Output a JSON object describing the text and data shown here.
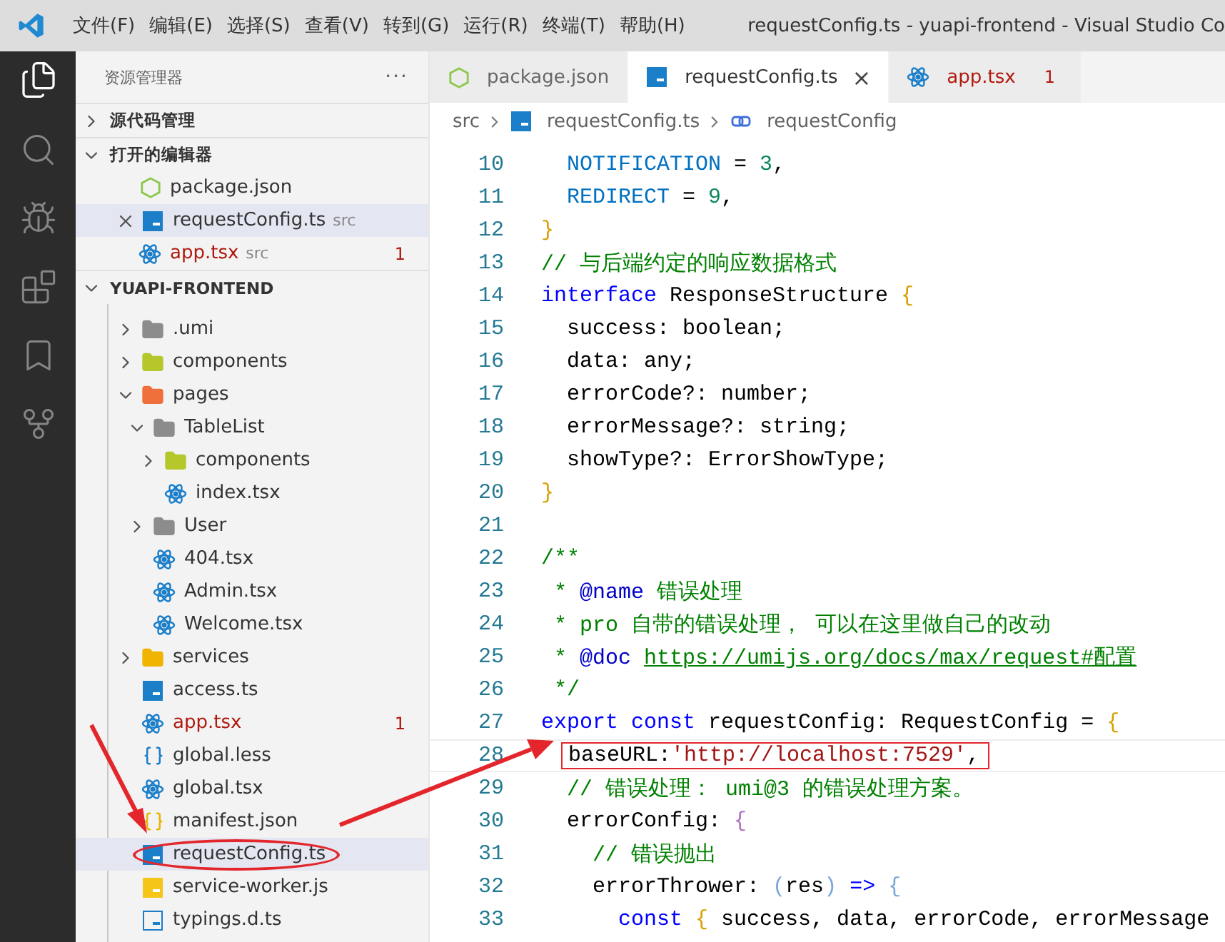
{
  "window": {
    "title": "requestConfig.ts - yuapi-frontend - Visual Studio Co"
  },
  "menu": [
    "文件(F)",
    "编辑(E)",
    "选择(S)",
    "查看(V)",
    "转到(G)",
    "运行(R)",
    "终端(T)",
    "帮助(H)"
  ],
  "activity_bar": [
    {
      "kind": "files",
      "selected": true
    },
    {
      "kind": "search",
      "selected": false
    },
    {
      "kind": "debug",
      "selected": false
    },
    {
      "kind": "extensions",
      "selected": false
    },
    {
      "kind": "bookmark",
      "selected": false
    },
    {
      "kind": "source",
      "selected": false
    }
  ],
  "sidebar": {
    "title": "资源管理器",
    "more": "···",
    "sections": [
      {
        "title": "源代码管理",
        "expanded": false
      },
      {
        "title": "打开的编辑器",
        "expanded": true
      },
      {
        "title": "YUAPI-FRONTEND",
        "expanded": true
      }
    ],
    "open_editors": [
      {
        "name": "package.json",
        "kind": "json",
        "selected": false,
        "error": false
      },
      {
        "name": "requestConfig.ts",
        "folder": "src",
        "kind": "ts",
        "selected": true,
        "error": false
      },
      {
        "name": "app.tsx",
        "folder": "src",
        "kind": "react",
        "selected": false,
        "error": true,
        "badge": "1"
      }
    ],
    "tree": [
      {
        "name": ".umi",
        "kind": "folder",
        "expanded": false
      },
      {
        "name": "components",
        "kind": "folder-components",
        "expanded": false
      },
      {
        "name": "pages",
        "kind": "folder-pages",
        "expanded": true,
        "children": [
          {
            "name": "TableList",
            "kind": "folder",
            "expanded": true,
            "children": [
              {
                "name": "components",
                "kind": "folder-components",
                "expanded": false
              },
              {
                "name": "index.tsx",
                "kind": "react"
              }
            ]
          },
          {
            "name": "User",
            "kind": "folder",
            "expanded": false
          },
          {
            "name": "404.tsx",
            "kind": "react"
          },
          {
            "name": "Admin.tsx",
            "kind": "react"
          },
          {
            "name": "Welcome.tsx",
            "kind": "react"
          }
        ]
      },
      {
        "name": "services",
        "kind": "folder-services",
        "expanded": false
      },
      {
        "name": "access.ts",
        "kind": "ts"
      },
      {
        "name": "app.tsx",
        "kind": "react",
        "error": true,
        "badge": "1"
      },
      {
        "name": "global.less",
        "kind": "less"
      },
      {
        "name": "global.tsx",
        "kind": "react"
      },
      {
        "name": "manifest.json",
        "kind": "manifest"
      },
      {
        "name": "requestConfig.ts",
        "kind": "ts",
        "selected": true,
        "circled": true
      },
      {
        "name": "service-worker.js",
        "kind": "js"
      },
      {
        "name": "typings.d.ts",
        "kind": "ts-outline"
      }
    ]
  },
  "tabs": [
    {
      "label": "package.json",
      "kind": "json",
      "selected": false,
      "error": false
    },
    {
      "label": "requestConfig.ts",
      "kind": "ts",
      "selected": true,
      "error": false,
      "close": "×"
    },
    {
      "label": "app.tsx",
      "kind": "react",
      "selected": false,
      "error": true,
      "badge": "1"
    }
  ],
  "breadcrumb": [
    {
      "label": "src",
      "kind": "folder"
    },
    {
      "label": "requestConfig.ts",
      "kind": "ts"
    },
    {
      "label": "requestConfig",
      "kind": "symbol"
    }
  ],
  "editor": {
    "lines": [
      {
        "number": "10",
        "tokens": [
          {
            "kind": "enum",
            "text": "  NOTIFICATION"
          },
          {
            "kind": "plain",
            "text": " = "
          },
          {
            "kind": "number",
            "text": "3"
          },
          {
            "kind": "plain",
            "text": ","
          }
        ]
      },
      {
        "number": "11",
        "tokens": [
          {
            "kind": "enum",
            "text": "  REDIRECT"
          },
          {
            "kind": "plain",
            "text": " = "
          },
          {
            "kind": "number",
            "text": "9"
          },
          {
            "kind": "plain",
            "text": ","
          }
        ]
      },
      {
        "number": "12",
        "tokens": [
          {
            "kind": "brace",
            "text": "}"
          }
        ]
      },
      {
        "number": "13",
        "tokens": [
          {
            "kind": "comment",
            "text": "// 与后端约定的响应数据格式"
          }
        ]
      },
      {
        "number": "14",
        "tokens": [
          {
            "kind": "keyword",
            "text": "interface"
          },
          {
            "kind": "plain",
            "text": " ResponseStructure "
          },
          {
            "kind": "brace",
            "text": "{"
          }
        ]
      },
      {
        "number": "15",
        "tokens": [
          {
            "kind": "plain",
            "text": "  success: boolean;"
          }
        ]
      },
      {
        "number": "16",
        "tokens": [
          {
            "kind": "plain",
            "text": "  data: any;"
          }
        ]
      },
      {
        "number": "17",
        "tokens": [
          {
            "kind": "plain",
            "text": "  errorCode?: number;"
          }
        ]
      },
      {
        "number": "18",
        "tokens": [
          {
            "kind": "plain",
            "text": "  errorMessage?: string;"
          }
        ]
      },
      {
        "number": "19",
        "tokens": [
          {
            "kind": "plain",
            "text": "  showType?: ErrorShowType;"
          }
        ]
      },
      {
        "number": "20",
        "tokens": [
          {
            "kind": "brace",
            "text": "}"
          }
        ]
      },
      {
        "number": "21"
      },
      {
        "number": "22",
        "tokens": [
          {
            "kind": "comment",
            "text": "/**"
          }
        ]
      },
      {
        "number": "23",
        "tokens": [
          {
            "kind": "comment",
            "text": " * "
          },
          {
            "kind": "tag",
            "text": "@name"
          },
          {
            "kind": "comment",
            "text": " 错误处理"
          }
        ]
      },
      {
        "number": "24",
        "tokens": [
          {
            "kind": "comment",
            "text": " * pro 自带的错误处理， 可以在这里做自己的改动"
          }
        ]
      },
      {
        "number": "25",
        "tokens": [
          {
            "kind": "comment",
            "text": " * "
          },
          {
            "kind": "tag",
            "text": "@doc "
          },
          {
            "kind": "link",
            "text": "https://umijs.org/docs/max/request#配置"
          }
        ]
      },
      {
        "number": "26",
        "tokens": [
          {
            "kind": "comment",
            "text": " */"
          }
        ]
      },
      {
        "number": "27",
        "tokens": [
          {
            "kind": "keyword",
            "text": "export "
          },
          {
            "kind": "keyword",
            "text": "const"
          },
          {
            "kind": "plain",
            "text": " requestConfig: RequestConfig = "
          },
          {
            "kind": "brace",
            "text": "{"
          }
        ]
      },
      {
        "number": "28",
        "current": true,
        "annotated": true,
        "tokens": [
          {
            "kind": "plain",
            "text": "baseURL:"
          },
          {
            "kind": "string",
            "text": "'http://localhost:7529'"
          },
          {
            "kind": "plain",
            "text": ","
          }
        ]
      },
      {
        "number": "29",
        "tokens": [
          {
            "kind": "comment",
            "text": "  // 错误处理： umi@3 的错误处理方案。"
          }
        ]
      },
      {
        "number": "30",
        "tokens": [
          {
            "kind": "plain",
            "text": "  errorConfig: "
          },
          {
            "kind": "brace2",
            "text": "{"
          }
        ]
      },
      {
        "number": "31",
        "tokens": [
          {
            "kind": "comment",
            "text": "    // 错误抛出"
          }
        ]
      },
      {
        "number": "32",
        "tokens": [
          {
            "kind": "plain",
            "text": "    errorThrower: "
          },
          {
            "kind": "paren",
            "text": "("
          },
          {
            "kind": "plain",
            "text": "res"
          },
          {
            "kind": "paren",
            "text": ")"
          },
          {
            "kind": "keyword",
            "text": " =>"
          },
          {
            "kind": "paren",
            "text": " {"
          }
        ]
      },
      {
        "number": "33",
        "tokens": [
          {
            "kind": "keyword",
            "text": "      const "
          },
          {
            "kind": "brace",
            "text": "{"
          },
          {
            "kind": "plain",
            "text": " success, data, errorCode, errorMessage"
          }
        ]
      }
    ]
  },
  "annotations": [
    {
      "kind": "arrow"
    },
    {
      "kind": "arrow"
    }
  ]
}
